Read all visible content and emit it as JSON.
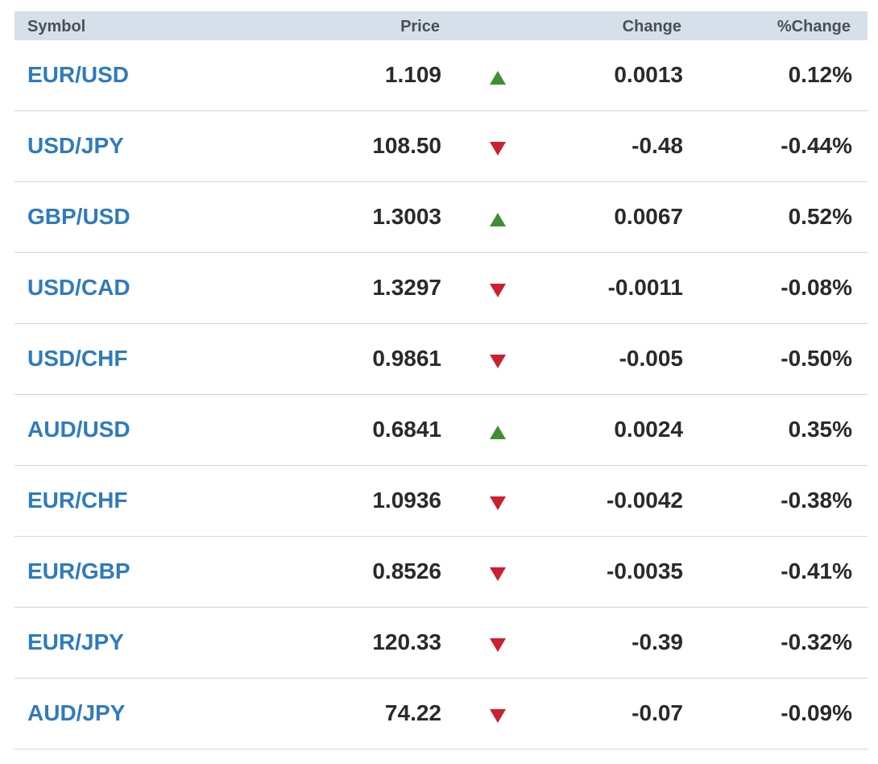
{
  "header": {
    "symbol": "Symbol",
    "price": "Price",
    "change": "Change",
    "pct_change": "%Change"
  },
  "colors": {
    "header_bg": "#d6e0ea",
    "symbol_link": "#2f7bbd",
    "up": "#3f8f32",
    "down": "#cc1f2f"
  },
  "rows": [
    {
      "symbol": "EUR/USD",
      "price": "1.109",
      "direction": "up",
      "direction_icon": "triangle-up-icon",
      "change": "0.0013",
      "pct_change": "0.12%"
    },
    {
      "symbol": "USD/JPY",
      "price": "108.50",
      "direction": "down",
      "direction_icon": "triangle-down-icon",
      "change": "-0.48",
      "pct_change": "-0.44%"
    },
    {
      "symbol": "GBP/USD",
      "price": "1.3003",
      "direction": "up",
      "direction_icon": "triangle-up-icon",
      "change": "0.0067",
      "pct_change": "0.52%"
    },
    {
      "symbol": "USD/CAD",
      "price": "1.3297",
      "direction": "down",
      "direction_icon": "triangle-down-icon",
      "change": "-0.0011",
      "pct_change": "-0.08%"
    },
    {
      "symbol": "USD/CHF",
      "price": "0.9861",
      "direction": "down",
      "direction_icon": "triangle-down-icon",
      "change": "-0.005",
      "pct_change": "-0.50%"
    },
    {
      "symbol": "AUD/USD",
      "price": "0.6841",
      "direction": "up",
      "direction_icon": "triangle-up-icon",
      "change": "0.0024",
      "pct_change": "0.35%"
    },
    {
      "symbol": "EUR/CHF",
      "price": "1.0936",
      "direction": "down",
      "direction_icon": "triangle-down-icon",
      "change": "-0.0042",
      "pct_change": "-0.38%"
    },
    {
      "symbol": "EUR/GBP",
      "price": "0.8526",
      "direction": "down",
      "direction_icon": "triangle-down-icon",
      "change": "-0.0035",
      "pct_change": "-0.41%"
    },
    {
      "symbol": "EUR/JPY",
      "price": "120.33",
      "direction": "down",
      "direction_icon": "triangle-down-icon",
      "change": "-0.39",
      "pct_change": "-0.32%"
    },
    {
      "symbol": "AUD/JPY",
      "price": "74.22",
      "direction": "down",
      "direction_icon": "triangle-down-icon",
      "change": "-0.07",
      "pct_change": "-0.09%"
    }
  ]
}
